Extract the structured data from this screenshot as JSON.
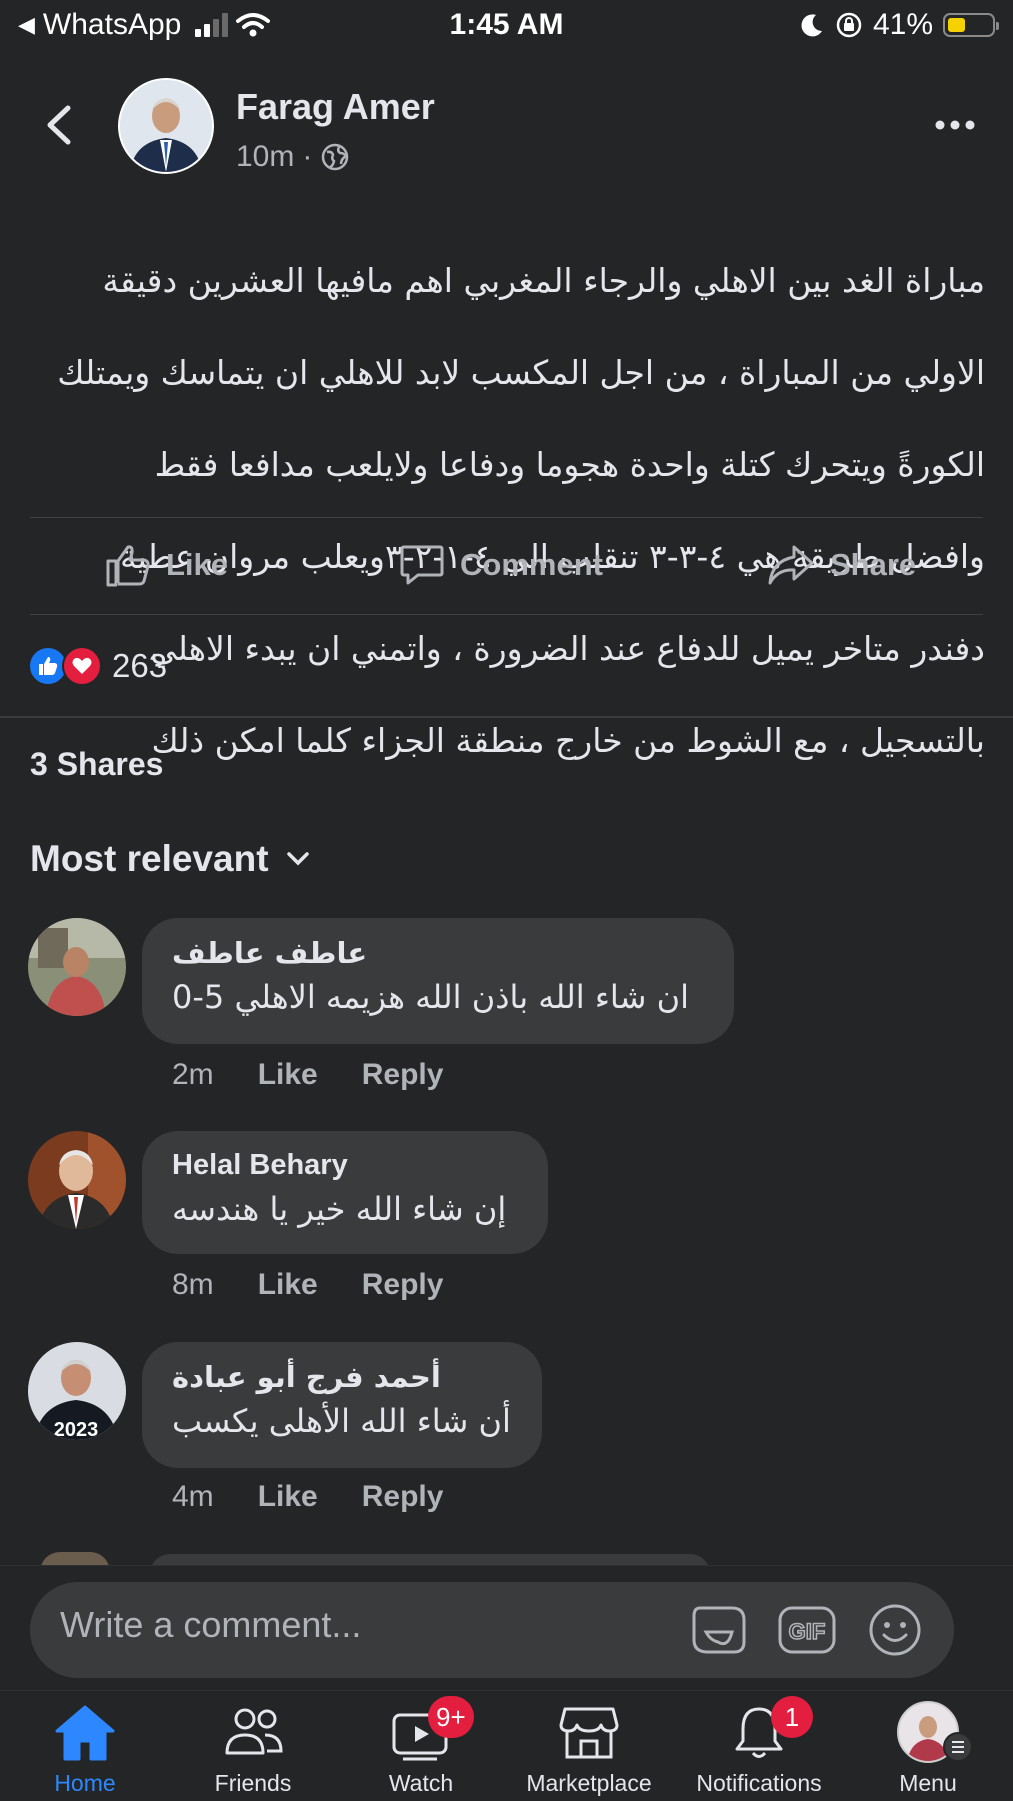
{
  "status_bar": {
    "back_app": "WhatsApp",
    "time": "1:45 AM",
    "battery": "41%",
    "battery_level": 0.41
  },
  "post": {
    "author": "Farag Amer",
    "time": "10m",
    "lines": [
      "مباراة الغد بين الاهلي والرجاء المغربي  اهم مافيها العشرين دقيقة",
      "الاولي من المباراة ، من اجل المكسب لابد للاهلي ان يتماسك ويمتلك",
      "الكورةً ويتحرك كتلة واحدة هجوما ودفاعا ولايلعب مدافعا فقط",
      "وافضل طريقة هي ٤-٣-٣  تنقلب الي ٤-١-٢-٣ويعلب مروان عطية",
      "دفندر متاخر يميل للدفاع عند الضرورة ، واتمني ان يبدء  الاهلي",
      "بالتسجيل ، مع  الشوط من خارج منطقة الجزاء كلما امكن ذلك"
    ],
    "actions": {
      "like": "Like",
      "comment": "Comment",
      "share": "Share"
    },
    "reaction_count": "263",
    "shares": "3 Shares"
  },
  "sort_label": "Most relevant",
  "comments": [
    {
      "name": "عاطف عاطف",
      "text": "ان شاء الله باذن الله هزيمه الاهلي 5-0",
      "time": "2m",
      "like": "Like",
      "reply": "Reply"
    },
    {
      "name": "Helal Behary",
      "text": "إن شاء الله خير يا هندسه",
      "time": "8m",
      "like": "Like",
      "reply": "Reply"
    },
    {
      "name": "أحمد فرج أبو عبادة",
      "text": "أن شاء الله الأهلى يكسب",
      "time": "4m",
      "like": "Like",
      "reply": "Reply",
      "avatar_text": "2023"
    }
  ],
  "composer": {
    "placeholder": "Write a comment..."
  },
  "nav": {
    "home": "Home",
    "friends": "Friends",
    "watch": "Watch",
    "watch_badge": "9+",
    "marketplace": "Marketplace",
    "notifications": "Notifications",
    "notifications_badge": "1",
    "menu": "Menu"
  },
  "colors": {
    "accent": "#2d88ff",
    "background": "#242526",
    "bubble": "#3a3b3c",
    "badge": "#e41e3f"
  }
}
